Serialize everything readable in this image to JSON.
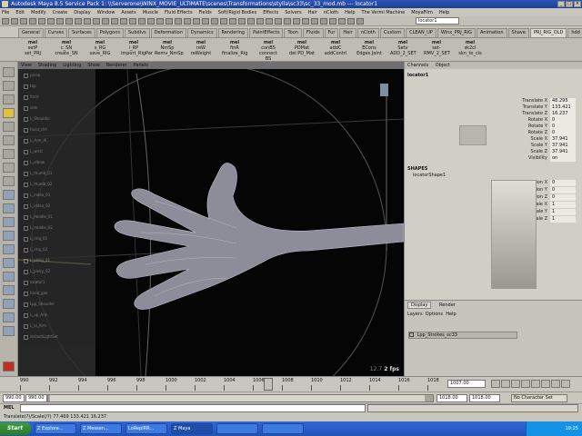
{
  "window": {
    "title": "Autodesk Maya 8.5 Service Pack 1: \\\\Serverone\\WINX_MOVIE_ULTIMATE\\scenes\\Transformations\\stylla\\sc33\\sc_33_mod.mb --- locator1",
    "min": "_",
    "max": "□",
    "close": "×"
  },
  "menubar": [
    "File",
    "Edit",
    "Modify",
    "Create",
    "Display",
    "Window",
    "Assets",
    "Muscle",
    "Fluid Effects",
    "Fields",
    "Soft/Rigid Bodies",
    "Effects",
    "Solvers",
    "Hair",
    "nCloth",
    "Help",
    "The Vermi Machine",
    "MoyaFilm",
    "Help"
  ],
  "status_search": "locator1",
  "shelf_tabs": [
    "General",
    "Curves",
    "Surfaces",
    "Polygons",
    "Subdivs",
    "Deformation",
    "Dynamics",
    "Rendering",
    "PaintEffects",
    "Toon",
    "Fluids",
    "Fur",
    "Hair",
    "nCloth",
    "Custom",
    "CLEAN_UP",
    "Winx_PRJ_RIG",
    "Animation",
    "Shave",
    "PRJ_RIG_OLD",
    "hdd"
  ],
  "shelf_active_index": 19,
  "shelf_buttons": [
    {
      "top": "mel",
      "a": "setP",
      "b": "set_PRJ"
    },
    {
      "top": "mel",
      "a": "c_SN",
      "b": "create_SN"
    },
    {
      "top": "mel",
      "a": "s_RG",
      "b": "save_RIG"
    },
    {
      "top": "mel",
      "a": "i_RP",
      "b": "import_RigPar"
    },
    {
      "top": "mel",
      "a": "NmSp",
      "b": "Remv_NmSp"
    },
    {
      "top": "mel",
      "a": "reW",
      "b": "reWeight"
    },
    {
      "top": "mel",
      "a": "finR",
      "b": "finalize_Rig"
    },
    {
      "top": "mel",
      "a": "conBS",
      "b": "connect BS"
    },
    {
      "top": "mel",
      "a": "PDMat",
      "b": "del PD_Mat"
    },
    {
      "top": "mel",
      "a": "addC",
      "b": "addContrl"
    },
    {
      "top": "mel",
      "a": "ECons",
      "b": "Edges Joint"
    },
    {
      "top": "mel",
      "a": "Setv",
      "b": "ADD_2_SET"
    },
    {
      "top": "mel",
      "a": "set-",
      "b": "RMV_2_SET"
    },
    {
      "top": "mel",
      "a": "sk2cl",
      "b": "skn_to_cls"
    }
  ],
  "viewport": {
    "panel_menu": [
      "View",
      "Shading",
      "Lighting",
      "Show",
      "Renderer",
      "Panels"
    ],
    "fps_value": "12.7",
    "fps_label": "2 fps",
    "outliner_items": [
      "persp",
      "top",
      "front",
      "side",
      "L_Shoulder",
      "hand_ctrl",
      "L_Arm_IK",
      "L_wrist",
      "L_elbow",
      "L_thumb_01",
      "L_thumb_02",
      "L_index_01",
      "L_index_02",
      "L_middle_01",
      "L_middle_02",
      "L_ring_01",
      "L_ring_02",
      "L_pinky_01",
      "L_pinky_02",
      "locator1",
      "hand_geo",
      "Lpp_Shoulder",
      "L_up_Arm",
      "L_lo_Arm",
      "defaultLightSet"
    ]
  },
  "channel_box": {
    "tabs": [
      "Channels",
      "Object"
    ],
    "object": "locator1",
    "attributes": [
      {
        "name": "Translate X",
        "value": "48.295"
      },
      {
        "name": "Translate Y",
        "value": "133.421"
      },
      {
        "name": "Translate Z",
        "value": "16.237"
      },
      {
        "name": "Rotate X",
        "value": "0"
      },
      {
        "name": "Rotate Y",
        "value": "0"
      },
      {
        "name": "Rotate Z",
        "value": "0"
      },
      {
        "name": "Scale X",
        "value": "37.941"
      },
      {
        "name": "Scale Y",
        "value": "37.941"
      },
      {
        "name": "Scale Z",
        "value": "37.941"
      },
      {
        "name": "Visibility",
        "value": "on"
      }
    ],
    "shapes_label": "SHAPES",
    "shape_name": "locatorShape1",
    "shape_attributes": [
      {
        "name": "Local Position X",
        "value": "0"
      },
      {
        "name": "Local Position Y",
        "value": "0"
      },
      {
        "name": "Local Position Z",
        "value": "0"
      },
      {
        "name": "Local Scale X",
        "value": "1"
      },
      {
        "name": "Local Scale Y",
        "value": "1"
      },
      {
        "name": "Local Scale Z",
        "value": "1"
      }
    ],
    "layer_tabs": [
      "Display",
      "Render"
    ],
    "layer_menu": [
      "Layers",
      "Options",
      "Help"
    ],
    "layer_item": "Lpp_Strokes_sc33"
  },
  "timeline": {
    "ticks": [
      "990",
      "992",
      "994",
      "996",
      "998",
      "1000",
      "1002",
      "1004",
      "1006",
      "1008",
      "1010",
      "1012",
      "1014",
      "1016",
      "1018"
    ],
    "current_frame": "1007.00"
  },
  "range": {
    "start": "990.00",
    "inner_start": "990.00",
    "inner_end": "1018.00",
    "end": "1018.00",
    "char_set": "No Character Set"
  },
  "mel_label": "MEL",
  "help_line": "Translate(?)/Scale(/?)    77.469    133.421    16.237",
  "taskbar": {
    "start": "Start",
    "tasks": [
      "Z Explore...",
      "Z Messen...",
      "LoReplRR...",
      "Z Maya",
      "",
      ""
    ],
    "tray_time": "19:25"
  },
  "colors": {
    "viewport_bg": "#050505",
    "maya_gray": "#c9c6bd",
    "taskbar_blue": "#2252b9",
    "start_green": "#3c9c3c"
  }
}
